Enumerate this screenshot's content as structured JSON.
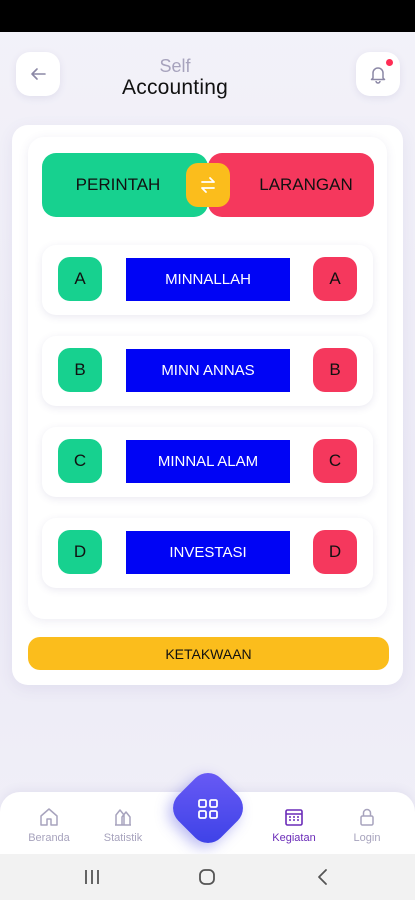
{
  "header": {
    "title_small": "Self",
    "title_main": "Accounting"
  },
  "panel": {
    "left_header": "PERINTAH",
    "right_header": "LARANGAN",
    "rows": [
      {
        "left": "A",
        "label": "MINNALLAH",
        "right": "A"
      },
      {
        "left": "B",
        "label": "MINN ANNAS",
        "right": "B"
      },
      {
        "left": "C",
        "label": "MINNAL ALAM",
        "right": "C"
      },
      {
        "left": "D",
        "label": "INVESTASI",
        "right": "D"
      }
    ],
    "cta": "KETAKWAAN"
  },
  "nav": {
    "items": [
      {
        "label": "Beranda",
        "icon": "home-icon"
      },
      {
        "label": "Statistik",
        "icon": "stats-icon"
      },
      {
        "label": "Kegiatan",
        "icon": "calendar-icon",
        "active": true
      },
      {
        "label": "Login",
        "icon": "lock-icon"
      }
    ],
    "fab_icon": "grid-icon"
  },
  "colors": {
    "green": "#17d18f",
    "red": "#f5385d",
    "yellow": "#fbbd1c",
    "blue": "#0004f5",
    "active_nav": "#6a2bb8"
  }
}
